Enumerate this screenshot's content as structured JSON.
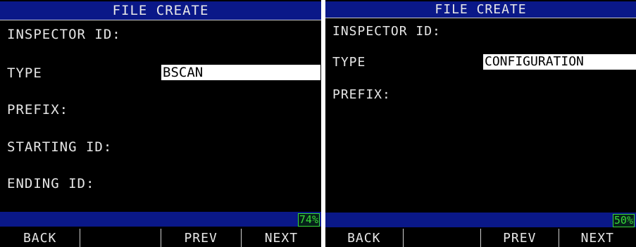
{
  "left": {
    "title": "FILE CREATE",
    "fields": {
      "inspector_id": "INSPECTOR ID:",
      "type": "TYPE",
      "prefix": "PREFIX:",
      "starting_id": "STARTING ID:",
      "ending_id": "ENDING ID:"
    },
    "type_value": "BSCAN",
    "battery": "74%",
    "softkeys": [
      "BACK",
      "",
      "PREV",
      "NEXT"
    ]
  },
  "right": {
    "title": "FILE CREATE",
    "fields": {
      "inspector_id": "INSPECTOR ID:",
      "type": "TYPE",
      "prefix": "PREFIX:"
    },
    "type_value": "CONFIGURATION",
    "battery": "50%",
    "softkeys": [
      "BACK",
      "",
      "PREV",
      "NEXT"
    ]
  },
  "colors": {
    "bar_blue": "#0a1888",
    "battery_green": "#38d838",
    "text": "#e6e6e6",
    "screen_bg": "#000000"
  }
}
